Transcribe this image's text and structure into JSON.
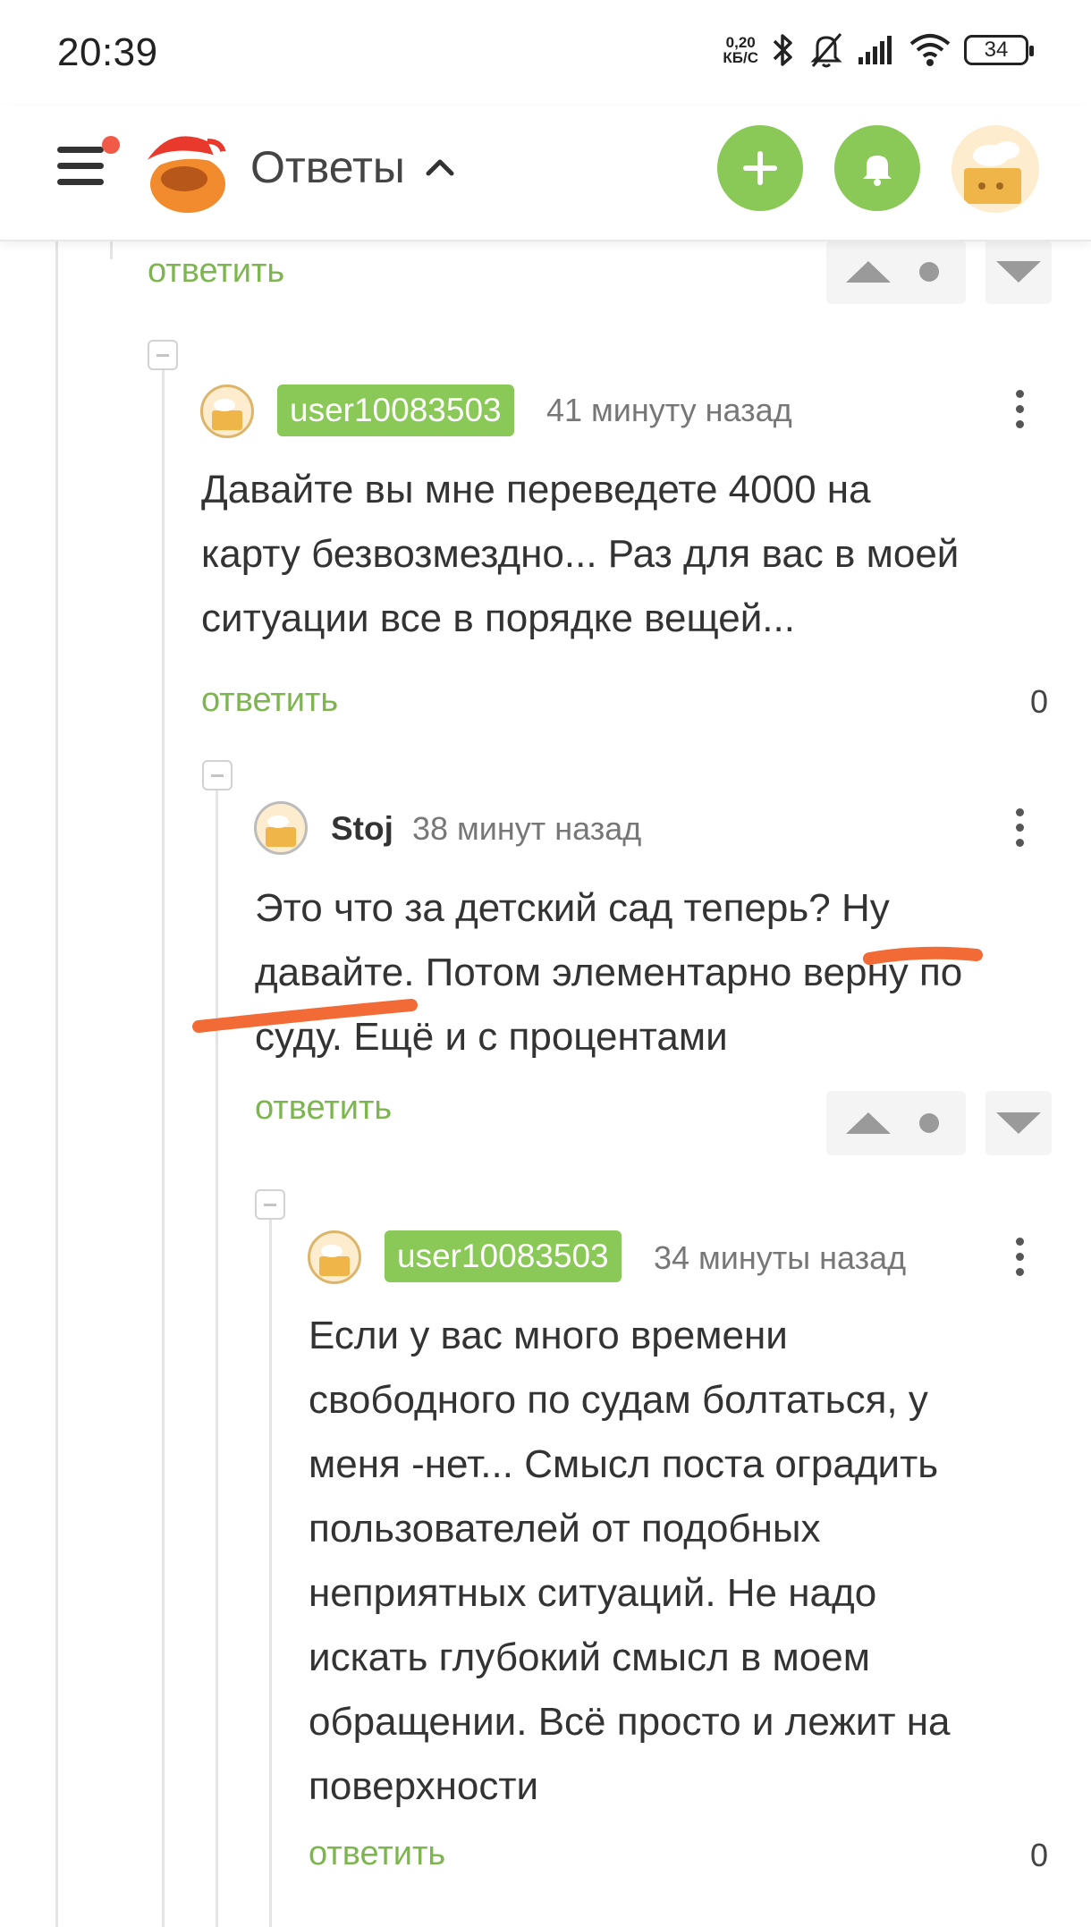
{
  "status_bar": {
    "time": "20:39",
    "net_speed_value": "0,20",
    "net_speed_unit": "КБ/С",
    "battery": "34",
    "icons": [
      "bluetooth-icon",
      "bell-off-icon",
      "signal-icon",
      "wifi-icon",
      "battery-icon"
    ]
  },
  "header": {
    "title": "Ответы",
    "icons": [
      "menu-icon",
      "logo-icon",
      "chevron-up-icon",
      "plus-icon",
      "bell-icon",
      "avatar"
    ]
  },
  "colors": {
    "accent_green": "#8ac858",
    "link_green": "#7db64e",
    "notification_dot": "#f05a47",
    "annotation_orange": "#f26a35"
  },
  "top_partial": {
    "reply_label": "ответить"
  },
  "comments": [
    {
      "username": "user10083503",
      "time": "41 минуту назад",
      "lines": [
        "Давайте вы мне переведете 4000 на",
        "карту безвозмездно... Раз для вас в моей",
        "ситуации все в порядке вещей..."
      ],
      "reply_label": "ответить",
      "score": "0"
    },
    {
      "username": "Stoj",
      "time": "38 минут назад",
      "lines": [
        "Это что за детский сад теперь? Ну",
        "давайте. Потом элементарно верну по",
        "суду. Ещё и с процентами"
      ],
      "reply_label": "ответить"
    },
    {
      "username": "user10083503",
      "time": "34 минуты назад",
      "lines": [
        "Если у вас много времени",
        "свободного по судам болтаться, у",
        "меня -нет... Смысл поста оградить",
        "пользователей от подобных",
        "неприятных ситуаций. Не надо",
        "искать глубокий смысл в моем",
        "обращении. Всё просто и лежит на",
        "поверхности"
      ],
      "reply_label": "ответить",
      "score": "0"
    }
  ]
}
